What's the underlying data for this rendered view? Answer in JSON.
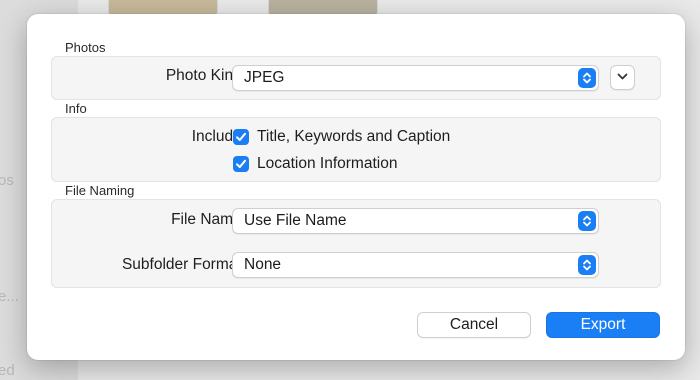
{
  "background": {
    "sidebar_fragments": [
      "os",
      "e...",
      "ed"
    ]
  },
  "sections": {
    "photos": {
      "title": "Photos",
      "photo_kind_label": "Photo Kind:",
      "photo_kind_value": "JPEG"
    },
    "info": {
      "title": "Info",
      "include_label": "Include:",
      "options": [
        {
          "label": "Title, Keywords and Caption",
          "checked": true
        },
        {
          "label": "Location Information",
          "checked": true
        }
      ]
    },
    "file_naming": {
      "title": "File Naming",
      "file_name_label": "File Name:",
      "file_name_value": "Use File Name",
      "subfolder_label": "Subfolder Format:",
      "subfolder_value": "None"
    }
  },
  "buttons": {
    "cancel": "Cancel",
    "export": "Export"
  },
  "colors": {
    "accent": "#1a7ef5",
    "sheet_background": "#ffffff",
    "group_background": "#f5f5f5"
  },
  "icons": {
    "popup_stepper": "up-down-chevron-icon",
    "disclosure": "chevron-down-icon",
    "checkbox": "checkmark-icon"
  }
}
